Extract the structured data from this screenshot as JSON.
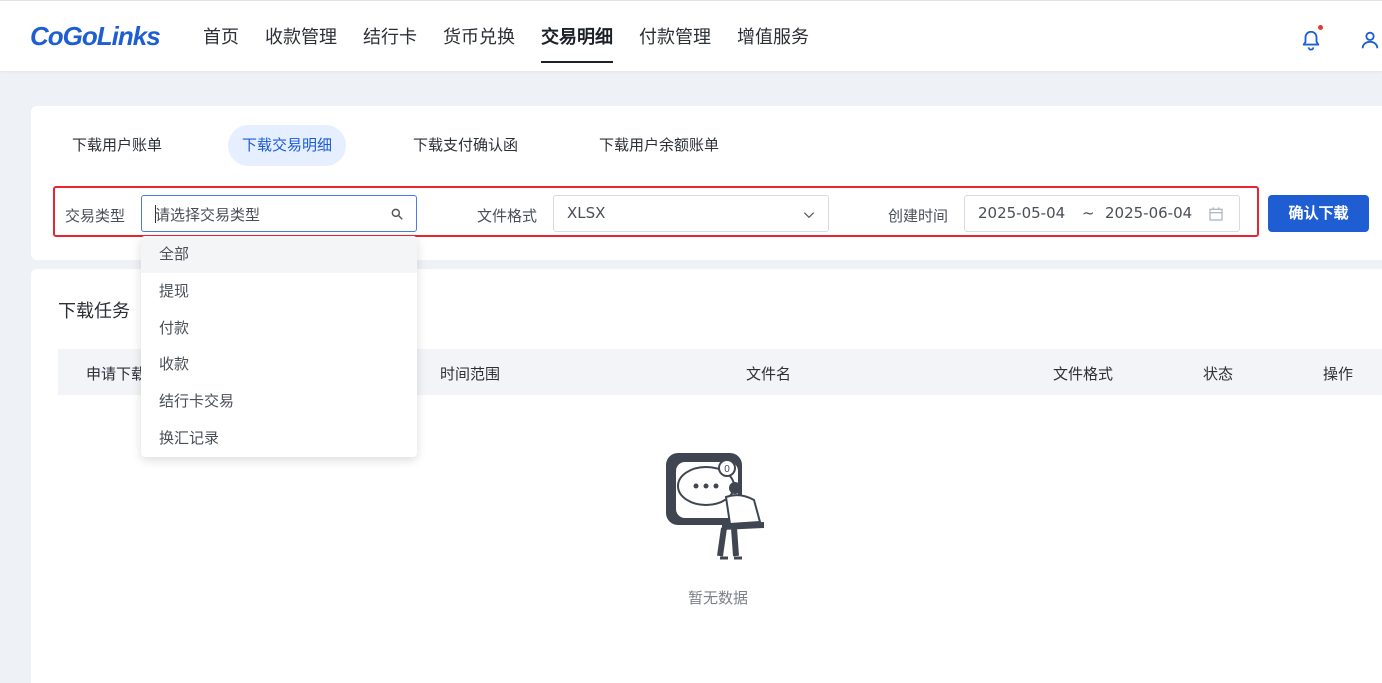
{
  "brand": {
    "logo_text": "CoGoLinks",
    "color": "#1e5ed2"
  },
  "nav": {
    "items": [
      {
        "label": "首页"
      },
      {
        "label": "收款管理"
      },
      {
        "label": "结行卡"
      },
      {
        "label": "货币兑换"
      },
      {
        "label": "交易明细",
        "active": true
      },
      {
        "label": "付款管理"
      },
      {
        "label": "增值服务"
      }
    ],
    "icons": [
      "bell-icon",
      "user-icon"
    ]
  },
  "tabs": [
    {
      "label": "下载用户账单"
    },
    {
      "label": "下载交易明细",
      "active": true
    },
    {
      "label": "下载支付确认函"
    },
    {
      "label": "下载用户余额账单"
    }
  ],
  "filters": {
    "type_label": "交易类型",
    "type_placeholder": "请选择交易类型",
    "format_label": "文件格式",
    "format_value": "XLSX",
    "created_label": "创建时间",
    "date_start": "2025-05-04",
    "date_sep": "~",
    "date_end": "2025-06-04",
    "confirm_label": "确认下载"
  },
  "type_options": [
    "全部",
    "提现",
    "付款",
    "收款",
    "结行卡交易",
    "换汇记录"
  ],
  "tasks": {
    "title": "下载任务",
    "columns": [
      "申请下载",
      "时间范围",
      "文件名",
      "文件格式",
      "状态",
      "操作"
    ],
    "empty_text": "暂无数据",
    "empty_badge": "0"
  },
  "colors": {
    "accent": "#1e5ed2",
    "highlight_border": "#e7262f",
    "notification_dot": "#e53935"
  }
}
